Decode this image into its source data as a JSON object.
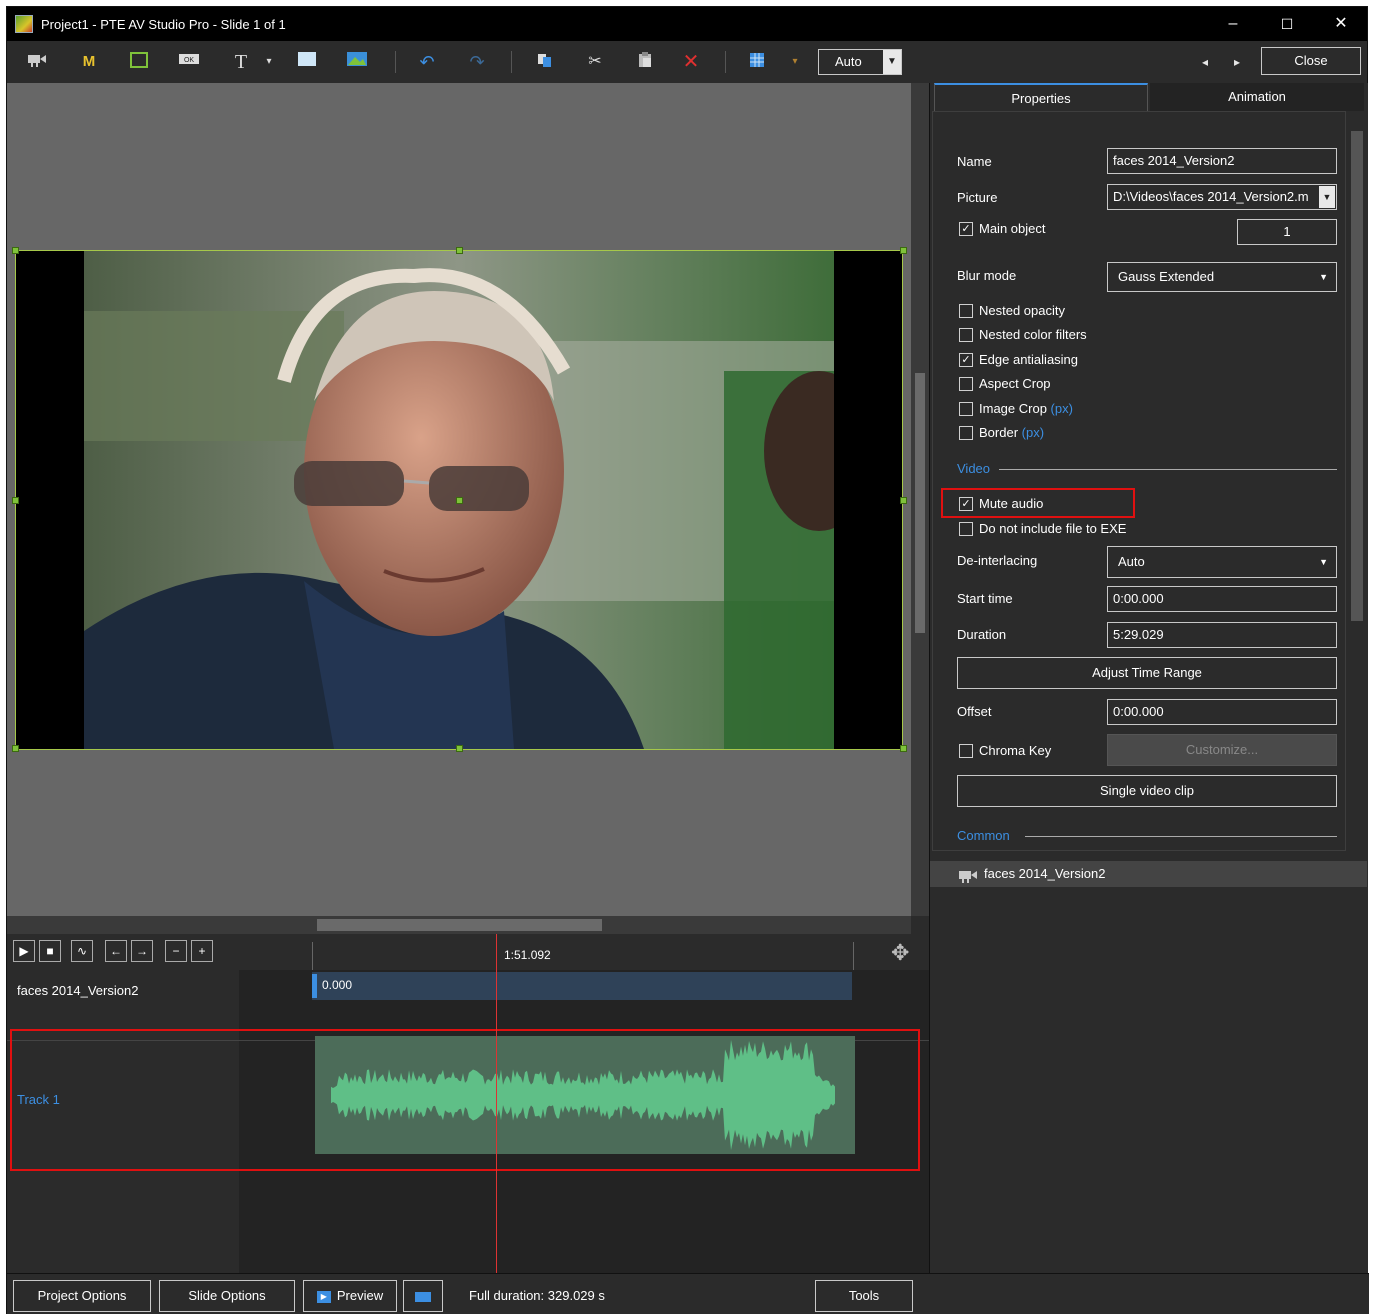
{
  "window": {
    "title": "Project1 - PTE AV Studio Pro - Slide 1 of 1",
    "minimize": "–",
    "maximize": "☐",
    "close": "✕"
  },
  "toolbar": {
    "zoom_value": "Auto",
    "close_label": "Close",
    "prev_icon": "◂",
    "next_icon": "▸",
    "m_label": "M",
    "t_label": "T"
  },
  "tabs": {
    "properties": "Properties",
    "animation": "Animation"
  },
  "properties": {
    "name_label": "Name",
    "name_value": "faces 2014_Version2",
    "picture_label": "Picture",
    "picture_value": "D:\\Videos\\faces 2014_Version2.m",
    "main_object_label": "Main object",
    "main_object_checked": true,
    "main_object_value": "1",
    "blur_mode_label": "Blur mode",
    "blur_mode_value": "Gauss Extended",
    "checkboxes": [
      {
        "label": "Nested opacity",
        "checked": false,
        "suffix": ""
      },
      {
        "label": "Nested color filters",
        "checked": false,
        "suffix": ""
      },
      {
        "label": "Edge antialiasing",
        "checked": true,
        "suffix": ""
      },
      {
        "label": "Aspect Crop",
        "checked": false,
        "suffix": ""
      },
      {
        "label": "Image Crop",
        "checked": false,
        "suffix": "(px)"
      },
      {
        "label": "Border",
        "checked": false,
        "suffix": "(px)"
      }
    ],
    "video_section": "Video",
    "mute_audio_label": "Mute audio",
    "mute_audio_checked": true,
    "exclude_label": "Do not include file to EXE",
    "exclude_checked": false,
    "deinterlacing_label": "De-interlacing",
    "deinterlacing_value": "Auto",
    "start_time_label": "Start time",
    "start_time_value": "0:00.000",
    "duration_label": "Duration",
    "duration_value": "5:29.029",
    "adjust_time_range": "Adjust Time Range",
    "offset_label": "Offset",
    "offset_value": "0:00.000",
    "chroma_key_label": "Chroma Key",
    "chroma_key_checked": false,
    "customize_label": "Customize...",
    "single_video_clip": "Single video clip",
    "common_section": "Common"
  },
  "object_list": {
    "item": "faces 2014_Version2"
  },
  "timeline": {
    "time_marker": "1:51.092",
    "object_track_name": "faces 2014_Version2",
    "object_track_time": "0.000",
    "audio_track_name": "Track 1"
  },
  "bottom": {
    "project_options": "Project Options",
    "slide_options": "Slide Options",
    "preview": "Preview",
    "full_duration": "Full duration: 329.029 s",
    "tools": "Tools"
  },
  "colors": {
    "accent_blue": "#3c8fe2",
    "highlight_red": "#e01010",
    "selection_green": "#a6c84a",
    "waveform_green": "#5fbf87"
  }
}
